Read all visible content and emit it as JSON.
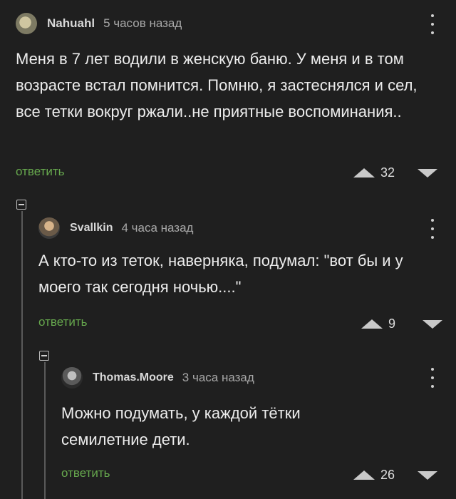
{
  "comments": [
    {
      "username": "Nahuahl",
      "time": "5 часов назад",
      "text": "Меня в 7 лет водили в женскую баню. У меня и в том возрасте встал помнится. Помню, я застеснялся и сел, все тетки вокруг ржали..не приятные воспоминания..",
      "reply_label": "ответить",
      "score": "32",
      "avatar_icon": "avatar-image"
    },
    {
      "username": "Svallkin",
      "time": "4 часа назад",
      "text": "А кто-то из теток, наверняка, подумал: \"вот бы и у моего так сегодня ночью....\"",
      "reply_label": "ответить",
      "score": "9",
      "avatar_icon": "avatar-image"
    },
    {
      "username": "Thomas.Moore",
      "time": "3 часа назад",
      "text": "Можно подумать, у каждой тётки семилетние дети.",
      "reply_label": "ответить",
      "score": "26",
      "avatar_icon": "avatar-image"
    }
  ],
  "colors": {
    "background": "#1f1f1f",
    "reply_link": "#67a94e",
    "text": "#ececec"
  }
}
